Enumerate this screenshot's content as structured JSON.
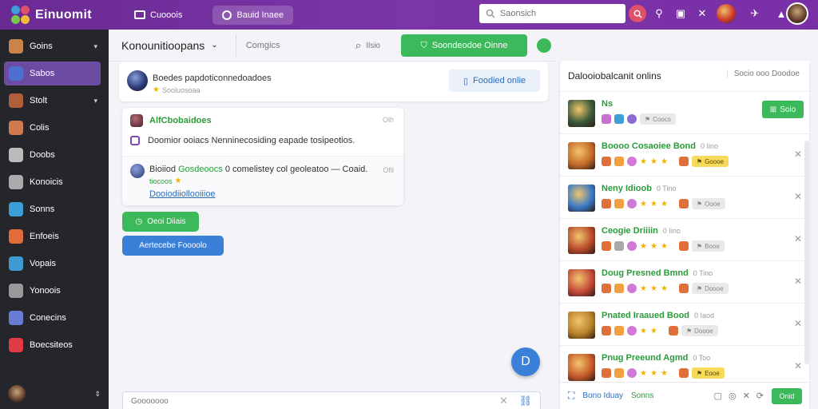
{
  "app": {
    "brand": "Einuomit",
    "colors": {
      "topbar": "#7b35a8",
      "accent_green": "#3cb95a",
      "accent_blue": "#3a7fd8",
      "sidebar": "#25262b"
    }
  },
  "topnav": {
    "items": [
      {
        "label": "Cuooois",
        "icon": "monitor-icon"
      },
      {
        "label": "Bauid Inaee",
        "icon": "ring-icon",
        "active": true
      }
    ],
    "search_placeholder": "Saonsich",
    "icons": [
      "search-icon",
      "key-icon",
      "note-icon",
      "close-icon",
      "game-icon",
      "pin-icon",
      "alert-icon"
    ]
  },
  "sidebar": {
    "items": [
      {
        "label": "Goins",
        "has_chevron": true,
        "color": "#c9844a"
      },
      {
        "label": "Sabos",
        "active": true,
        "color": "#4e6fd0"
      },
      {
        "label": "Stolt",
        "has_chevron": true,
        "color": "#b15e3a"
      },
      {
        "label": "Colis",
        "color": "#d07a50"
      },
      {
        "label": "Doobs",
        "color": "#bbb"
      },
      {
        "label": "Konoicis",
        "color": "#aaa"
      },
      {
        "label": "Sonns",
        "color": "#3b9fd6"
      },
      {
        "label": "Enfoeis",
        "color": "#e26b3a"
      },
      {
        "label": "Vopais",
        "color": "#3f9ad1"
      },
      {
        "label": "Yonoois",
        "color": "#999"
      },
      {
        "label": "Conecins",
        "color": "#6a7bd3"
      },
      {
        "label": "Boecsiteos",
        "color": "#e23a44"
      }
    ]
  },
  "main": {
    "title": "Konounitioopans",
    "tab": "Comgics",
    "help_label": "Ilsio",
    "primary_label": "Soondeodoe Oinne",
    "post": {
      "title": "Boedes papdoticonnedoadoes",
      "sub": "Sooluosoaa",
      "follow_label": "Foodied onlie"
    },
    "thread": {
      "name": "AlfCbobaidoes",
      "time": "Olh",
      "message": "Doomior ooiacs Nenninecosiding eapade tosipeotios.",
      "reply": {
        "prefix": "Bioiiod",
        "highlight": "Gosdeoocs",
        "suffix": "0 comelistey col geoleatoo — Coaid.",
        "time": "Ofil",
        "sub": "tiocoos",
        "link": "Dooiodiiollooiiioe"
      }
    },
    "green_button": "Oeoi Diiais",
    "blue_button": "Aertecebe Foooolo",
    "composer_placeholder": "Gooooooo"
  },
  "right": {
    "title": "Dalooiobalcanit onlins",
    "link": "Socio ooo Doodoe",
    "save_label": "Soio",
    "friends": [
      {
        "name": "Ns",
        "time": "",
        "badges": [
          "#c86fd3",
          "#3aa0d6",
          "#8a6bd0"
        ],
        "chip": "Coocs",
        "chip_style": "grey",
        "primary": true,
        "avatar": "#3a5a3a"
      },
      {
        "name": "Boooo Cosaoiee Bond",
        "time": "0 Iino",
        "badges": [
          "#e0703a",
          "#f0a040",
          "#d07ad8"
        ],
        "stars": 3,
        "chip": "Goooe",
        "chip_style": "gold",
        "avatar": "#c46b2a"
      },
      {
        "name": "Neny Idioob",
        "time": "0 Tino",
        "badges": [
          "#e0703a",
          "#f0a040",
          "#d07ad8"
        ],
        "stars": 3,
        "chip": "Oooe",
        "chip_style": "grey",
        "avatar": "#3a7ac8"
      },
      {
        "name": "Ceogie Driiiin",
        "time": "0 Iino",
        "badges": [
          "#e0703a",
          "#aaa",
          "#d07ad8"
        ],
        "stars": 3,
        "chip": "Booe",
        "chip_style": "grey",
        "avatar": "#b94a2a"
      },
      {
        "name": "Doug Presned Bmnd",
        "time": "0 Tino",
        "badges": [
          "#e0703a",
          "#f0a040",
          "#d07ad8"
        ],
        "stars": 3,
        "chip": "Doooe",
        "chip_style": "grey",
        "avatar": "#c44a3a"
      },
      {
        "name": "Pnated Iraaued Bood",
        "time": "0 Iaod",
        "badges": [
          "#e0703a",
          "#f0a040",
          "#d07ad8"
        ],
        "stars": 2,
        "chip": "Doooe",
        "chip_style": "grey",
        "avatar": "#b8822a"
      },
      {
        "name": "Pnug Preeund Agmd",
        "time": "0 Too",
        "badges": [
          "#e0703a",
          "#f0a040",
          "#d07ad8"
        ],
        "stars": 3,
        "chip": "Eooe",
        "chip_style": "gold",
        "avatar": "#c85a2a"
      }
    ],
    "footer": {
      "left": "Bono Iduay",
      "games": "Sonns",
      "button": "Onid"
    }
  }
}
